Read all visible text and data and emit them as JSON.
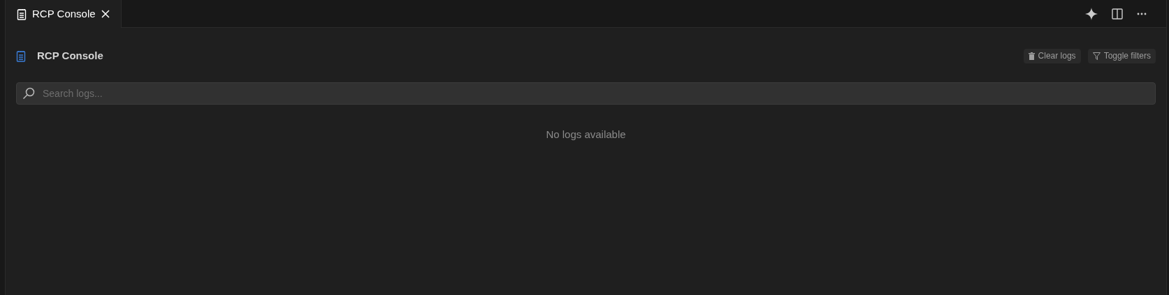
{
  "tabs": [
    {
      "label": "RCP Console",
      "selected": true
    }
  ],
  "header": {
    "title": "RCP Console",
    "buttons": [
      {
        "kind": "clear",
        "label": "Clear logs"
      },
      {
        "kind": "filter",
        "label": "Toggle filters"
      }
    ]
  },
  "search": {
    "placeholder": "Search logs..."
  },
  "empty_message": "No logs available"
}
